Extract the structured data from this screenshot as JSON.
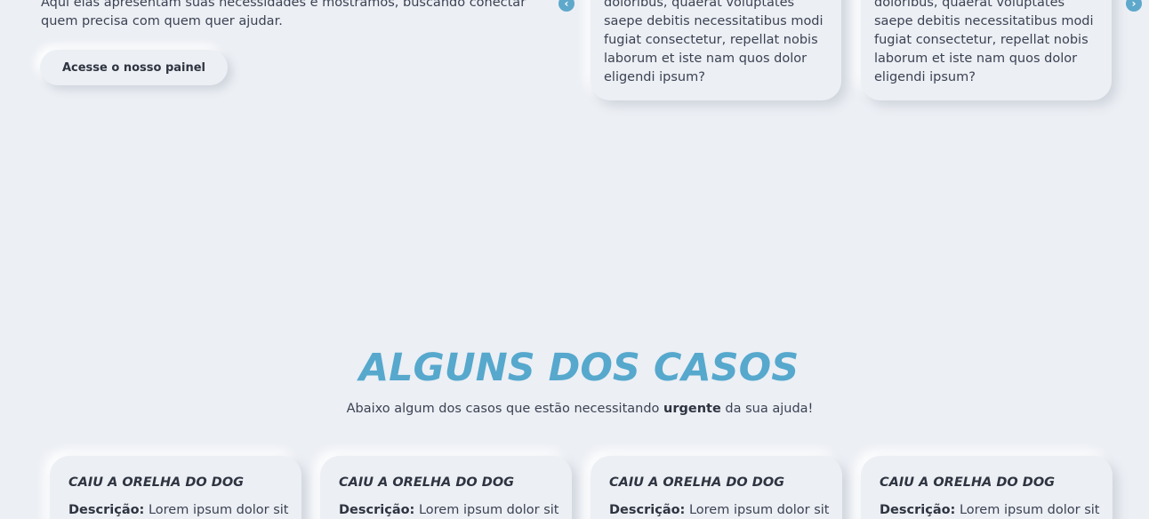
{
  "intro": {
    "text": "Aqui elas apresentam suas necessidades e mostramos, buscando conectar quem precisa com quem quer ajudar.",
    "button_label": "Acesse o nosso painel"
  },
  "carousel": {
    "prev_icon": "chevron-left-icon",
    "next_icon": "chevron-right-icon",
    "prev_glyph": "‹",
    "next_glyph": "›",
    "cards": [
      {
        "text": "doloribus, quaerat voluptates saepe debitis necessitatibus modi fugiat consectetur, repellat nobis laborum et iste nam quos dolor eligendi ipsum?"
      },
      {
        "text": "doloribus, quaerat voluptates saepe debitis necessitatibus modi fugiat consectetur, repellat nobis laborum et iste nam quos dolor eligendi ipsum?"
      }
    ]
  },
  "cases": {
    "title": "ALGUNS DOS CASOS",
    "subtitle_before": "Abaixo algum dos casos que estão necessitando ",
    "subtitle_bold": "urgente",
    "subtitle_after": " da sua ajuda!",
    "cards": [
      {
        "title": "CAIU A ORELHA DO DOG",
        "desc_label": "Descrição:",
        "desc_text": " Lorem ipsum dolor sit"
      },
      {
        "title": "CAIU A ORELHA DO DOG",
        "desc_label": "Descrição:",
        "desc_text": " Lorem ipsum dolor sit"
      },
      {
        "title": "CAIU A ORELHA DO DOG",
        "desc_label": "Descrição:",
        "desc_text": " Lorem ipsum dolor sit"
      },
      {
        "title": "CAIU A ORELHA DO DOG",
        "desc_label": "Descrição:",
        "desc_text": " Lorem ipsum dolor sit"
      }
    ]
  },
  "colors": {
    "background": "#eceff4",
    "accent": "#56a8cd",
    "text": "#3b4252",
    "heading_dark": "#2e3440"
  }
}
